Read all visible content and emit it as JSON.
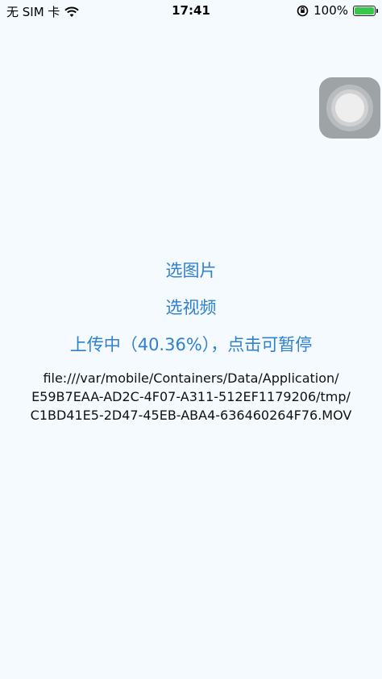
{
  "status_bar": {
    "carrier": "无 SIM 卡",
    "time": "17:41",
    "battery_percent": "100%",
    "battery_level": 1.0,
    "icons": [
      "wifi-icon",
      "lock-rotation-icon",
      "battery-icon"
    ],
    "battery_color": "#37c74b"
  },
  "assistive_touch": {
    "icon": "assistive-touch-icon"
  },
  "actions": {
    "select_image": "选图片",
    "select_video": "选视频",
    "upload_status": "上传中（40.36%），点击可暂停",
    "link_color": "#2f80cf"
  },
  "file_path": {
    "line1": "file:///var/mobile/Containers/Data/Application/",
    "line2": "E59B7EAA-AD2C-4F07-A311-512EF1179206/tmp/",
    "line3": "C1BD41E5-2D47-45EB-ABA4-636460264F76.MOV"
  }
}
